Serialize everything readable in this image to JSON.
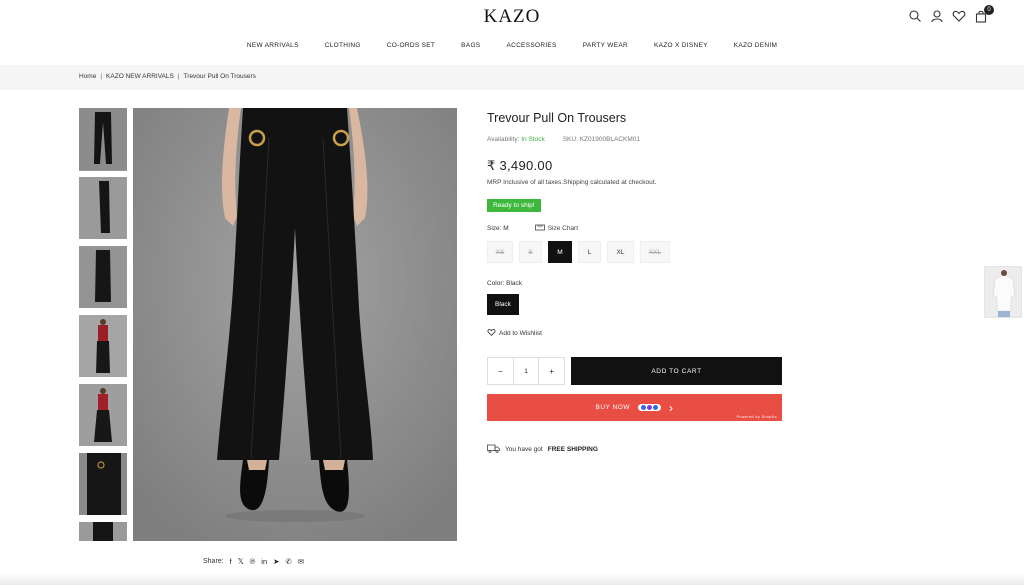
{
  "brand": "KAZO",
  "header": {
    "icons": [
      "search-icon",
      "user-icon",
      "heart-icon",
      "bag-icon"
    ],
    "cart_count": "0"
  },
  "nav": [
    "NEW ARRIVALS",
    "CLOTHING",
    "CO-ORDS SET",
    "BAGS",
    "ACCESSORIES",
    "PARTY WEAR",
    "KAZO X DISNEY",
    "KAZO DENIM"
  ],
  "breadcrumb": [
    "Home",
    "KAZO NEW ARRIVALS",
    "Trevour Pull On Trousers"
  ],
  "product": {
    "title": "Trevour Pull On Trousers",
    "availability_label": "Availability:",
    "availability_value": "In Stock",
    "sku_label": "SKU:",
    "sku_value": "KZ01900BLACKM01",
    "price": "₹ 3,490.00",
    "tax_note": "MRP Inclusive of all taxes.Shipping calculated at checkout.",
    "ready_badge": "Ready to ship!",
    "size_label": "Size:",
    "size_value": "M",
    "size_chart": "Size Chart",
    "sizes": [
      {
        "label": "XS",
        "state": "unavailable"
      },
      {
        "label": "S",
        "state": "unavailable"
      },
      {
        "label": "M",
        "state": "selected"
      },
      {
        "label": "L",
        "state": "available"
      },
      {
        "label": "XL",
        "state": "available"
      },
      {
        "label": "XXL",
        "state": "unavailable"
      }
    ],
    "color_label": "Color:",
    "color_value": "Black",
    "color_option": "Black",
    "wishlist": "Add to Wishlist",
    "qty_minus": "−",
    "qty_value": "1",
    "qty_plus": "+",
    "add_to_cart": "ADD TO CART",
    "buy_now": "BUY NOW",
    "buy_now_arrow": "›",
    "powered_by": "Powered by Shopflo",
    "shipping_prefix": "You have got",
    "shipping_bold": "FREE SHIPPING"
  },
  "share": {
    "label": "Share:",
    "icons": [
      "facebook-icon",
      "x-twitter-icon",
      "pinterest-icon",
      "linkedin-icon",
      "telegram-icon",
      "whatsapp-icon",
      "email-icon"
    ]
  },
  "colors": {
    "in_stock": "#3cb043",
    "ready_badge": "#3db83d",
    "buy_now": "#e94e45",
    "add_to_cart": "#111111",
    "breadcrumb_bg": "#f5f5f5"
  }
}
